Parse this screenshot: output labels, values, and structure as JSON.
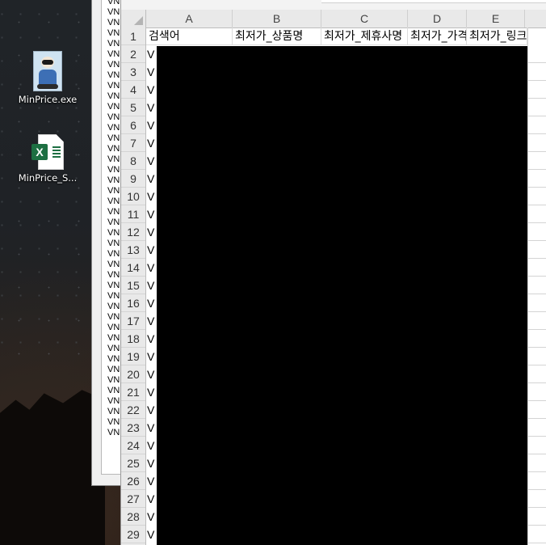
{
  "desktop": {
    "icons": [
      {
        "label": "MinPrice.exe",
        "icon": "app-character-icon"
      },
      {
        "label": "MinPrice_S...",
        "icon": "excel-file-icon"
      }
    ]
  },
  "background_window": {
    "lines": [
      "VN",
      "VN",
      "VN",
      "VN",
      "VN",
      "VN",
      "VN",
      "VN",
      "VN",
      "VN",
      "VN",
      "VN",
      "VN",
      "VN",
      "VN",
      "VN",
      "VN",
      "VN",
      "VN",
      "VN",
      "VN",
      "VN",
      "VN",
      "VN",
      "VN",
      "VN",
      "VN",
      "VN",
      "VN",
      "VN",
      "VN",
      "VN",
      "VN",
      "VN",
      "VN",
      "VN",
      "VN",
      "VN",
      "VN",
      "VN",
      "VN",
      "VN"
    ]
  },
  "spreadsheet": {
    "columns": [
      "A",
      "B",
      "C",
      "D",
      "E"
    ],
    "header_row": [
      "검색어",
      "최저가_상품명",
      "최저가_제휴사명",
      "최저가_가격",
      "최저가_링크"
    ],
    "row_numbers": [
      "1",
      "2",
      "3",
      "4",
      "5",
      "6",
      "7",
      "8",
      "9",
      "10",
      "11",
      "12",
      "13",
      "14",
      "15",
      "16",
      "17",
      "18",
      "19",
      "20",
      "21",
      "22",
      "23",
      "24",
      "25",
      "26",
      "27",
      "28",
      "29"
    ],
    "column_a_visible": [
      "V",
      "V",
      "V",
      "V",
      "V",
      "V",
      "V",
      "V",
      "V",
      "V",
      "V",
      "V",
      "V",
      "V",
      "V",
      "V",
      "V",
      "V",
      "V",
      "V",
      "V",
      "V",
      "V",
      "V",
      "V",
      "V",
      "V",
      "V"
    ]
  }
}
